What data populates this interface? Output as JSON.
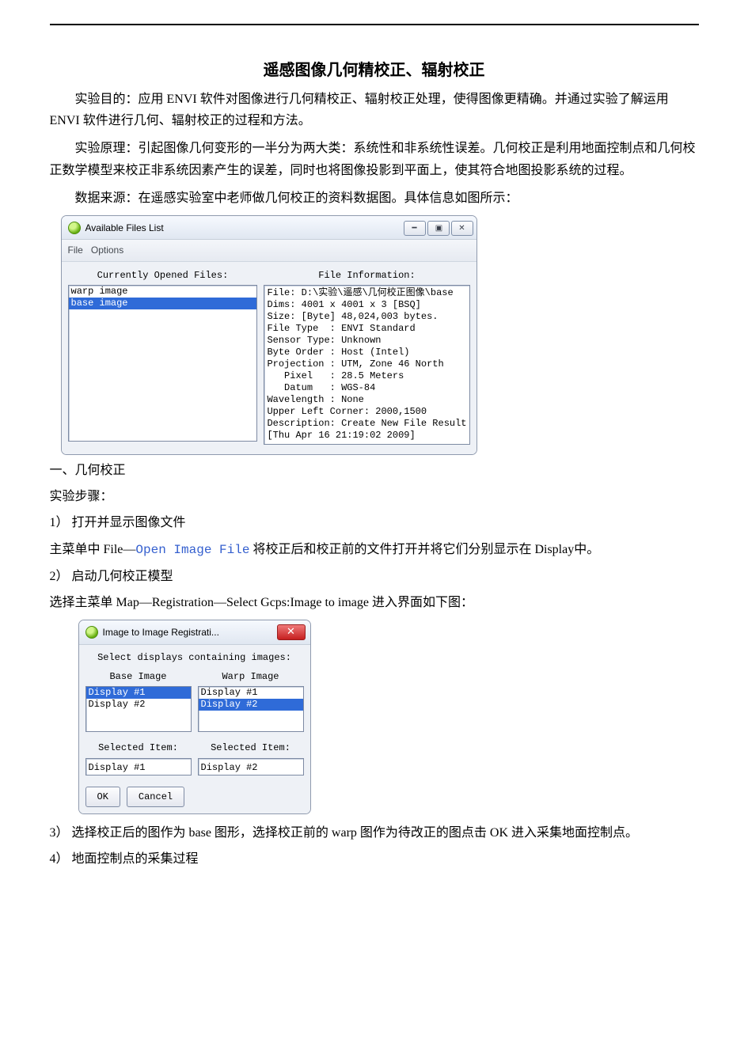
{
  "title": "遥感图像几何精校正、辐射校正",
  "p_objective": "实验目的：应用 ENVI 软件对图像进行几何精校正、辐射校正处理，使得图像更精确。并通过实验了解运用 ENVI 软件进行几何、辐射校正的过程和方法。",
  "p_principle": "实验原理：引起图像几何变形的一半分为两大类：系统性和非系统性误差。几何校正是利用地面控制点和几何校正数学模型来校正非系统因素产生的误差，同时也将图像投影到平面上，使其符合地图投影系统的过程。",
  "p_source": "数据来源：在遥感实验室中老师做几何校正的资料数据图。具体信息如图所示：",
  "win1": {
    "title": "Available Files List",
    "menu_file": "File",
    "menu_options": "Options",
    "left_header": "Currently Opened Files:",
    "right_header": "File Information:",
    "items": [
      "warp image",
      "base image"
    ],
    "selected_index": 1,
    "info": "File: D:\\实验\\遥感\\几何校正图像\\base\nDims: 4001 x 4001 x 3 [BSQ]\nSize: [Byte] 48,024,003 bytes.\nFile Type  : ENVI Standard\nSensor Type: Unknown\nByte Order : Host (Intel)\nProjection : UTM, Zone 46 North\n   Pixel   : 28.5 Meters\n   Datum   : WGS-84\nWavelength : None\nUpper Left Corner: 2000,1500\nDescription: Create New File Result\n[Thu Apr 16 21:19:02 2009]"
  },
  "sec1_h": "一、几何校正",
  "steps_h": "实验步骤：",
  "step1": "1） 打开并显示图像文件",
  "step1_desc_a": "主菜单中 File—",
  "step1_desc_b": "Open Image File",
  "step1_desc_c": " 将校正后和校正前的文件打开并将它们分别显示在 Display中。",
  "step2": "2） 启动几何校正模型",
  "step2_desc": "选择主菜单 Map—Registration—Select Gcps:Image to image 进入界面如下图：",
  "win2": {
    "title": "Image to Image Registrati...",
    "subtitle": "Select displays containing images:",
    "colA": "Base Image",
    "colB": "Warp Image",
    "itemsA": [
      "Display #1",
      "Display #2"
    ],
    "itemsB": [
      "Display #1",
      "Display #2"
    ],
    "selA_idx": 0,
    "selB_idx": 1,
    "selLabel": "Selected Item:",
    "selA": "Display #1",
    "selB": "Display #2",
    "ok": "OK",
    "cancel": "Cancel"
  },
  "step3": "3） 选择校正后的图作为 base 图形，选择校正前的 warp 图作为待改正的图点击 OK 进入采集地面控制点。",
  "step4": "4） 地面控制点的采集过程"
}
